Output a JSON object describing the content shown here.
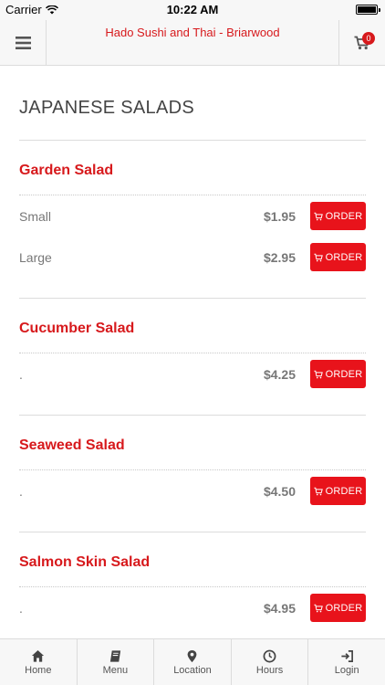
{
  "status_bar": {
    "carrier": "Carrier",
    "time": "10:22 AM"
  },
  "header": {
    "title": "Hado Sushi and Thai - Briarwood",
    "cart_count": "0"
  },
  "section": {
    "title": "JAPANESE SALADS"
  },
  "order_label": "ORDER",
  "items": [
    {
      "name": "Garden Salad",
      "variants": [
        {
          "name": "Small",
          "price": "$1.95"
        },
        {
          "name": "Large",
          "price": "$2.95"
        }
      ]
    },
    {
      "name": "Cucumber Salad",
      "variants": [
        {
          "name": ".",
          "price": "$4.25"
        }
      ]
    },
    {
      "name": "Seaweed Salad",
      "variants": [
        {
          "name": ".",
          "price": "$4.50"
        }
      ]
    },
    {
      "name": "Salmon Skin Salad",
      "variants": [
        {
          "name": ".",
          "price": "$4.95"
        }
      ]
    }
  ],
  "tabs": [
    {
      "label": "Home",
      "icon": "home-icon"
    },
    {
      "label": "Menu",
      "icon": "book-icon"
    },
    {
      "label": "Location",
      "icon": "map-pin-icon"
    },
    {
      "label": "Hours",
      "icon": "clock-icon"
    },
    {
      "label": "Login",
      "icon": "login-icon"
    }
  ],
  "colors": {
    "accent": "#d7191c",
    "button": "#e8131b",
    "bar_bg": "#f7f7f7"
  }
}
